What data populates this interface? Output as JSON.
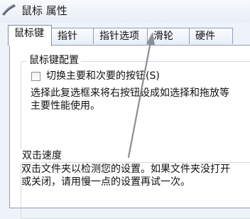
{
  "window": {
    "title": "鼠标 属性",
    "icon": "mouse-icon"
  },
  "tabs": [
    {
      "label": "鼠标键",
      "active": true
    },
    {
      "label": "指针",
      "active": false
    },
    {
      "label": "指针选项",
      "active": false
    },
    {
      "label": "滑轮",
      "active": false
    },
    {
      "label": "硬件",
      "active": false
    }
  ],
  "button_config": {
    "title": "鼠标键配置",
    "swap_checkbox_label": "切换主要和次要的按钮(S)",
    "swap_checked": false,
    "description_line1": "选择此复选框来将右按钮设成如选择和拖放等",
    "description_line2": "主要性能使用。"
  },
  "double_click": {
    "title": "双击速度",
    "description_line1": "双击文件夹以检测您的设置。如果文件夹没打开",
    "description_line2": "或关闭，请用慢一点的设置再试一次。"
  },
  "annotation": {
    "type": "arrow",
    "color": "#8a8f96",
    "points_to": "tab-wheel"
  }
}
